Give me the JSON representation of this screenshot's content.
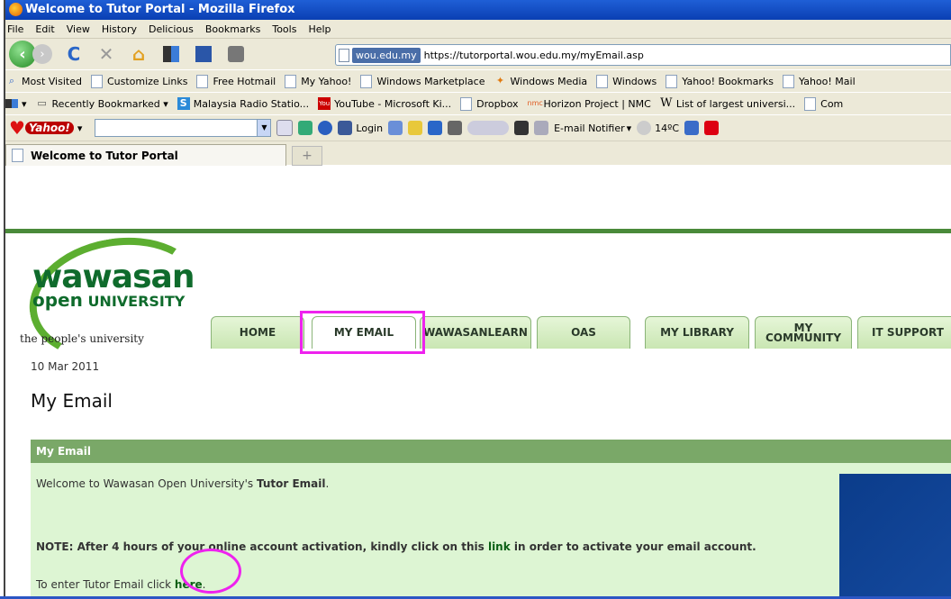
{
  "window": {
    "title": "Welcome to Tutor Portal - Mozilla Firefox"
  },
  "menu": [
    "File",
    "Edit",
    "View",
    "History",
    "Delicious",
    "Bookmarks",
    "Tools",
    "Help"
  ],
  "nav": {
    "site_badge": "wou.edu.my",
    "url": "https://tutorportal.wou.edu.my/myEmail.asp"
  },
  "bookmarks": [
    "Most Visited",
    "Customize Links",
    "Free Hotmail",
    "My Yahoo!",
    "Windows Marketplace",
    "Windows Media",
    "Windows",
    "Yahoo! Bookmarks",
    "Yahoo! Mail"
  ],
  "bookmarks2": [
    "Recently Bookmarked",
    "Malaysia Radio Statio...",
    "YouTube - Microsoft Ki...",
    "Dropbox",
    "Horizon Project | NMC",
    "List of largest universi...",
    "Com"
  ],
  "toolbar3": {
    "brand": "Yahoo!",
    "login": "Login",
    "notifier": "E-mail Notifier",
    "weather": "14ºC"
  },
  "tab": {
    "title": "Welcome to Tutor Portal"
  },
  "site": {
    "logo_word": "wawasan",
    "logo_open": "open",
    "logo_uni": "UNIVERSITY",
    "tagline": "the people's university",
    "tabs": [
      "HOME",
      "MY EMAIL",
      "WAWASANLEARN",
      "OAS",
      "MY LIBRARY",
      "MY COMMUNITY",
      "IT SUPPORT"
    ]
  },
  "page": {
    "date": "10 Mar 2011",
    "heading": "My Email",
    "panel_title": "My Email",
    "welcome_prefix": "Welcome to Wawasan Open University's ",
    "welcome_bold": "Tutor Email",
    "welcome_suffix": ".",
    "note_prefix": "NOTE: After 4 hours of your online account activation, kindly click on this ",
    "note_link": "link",
    "note_suffix": " in order to activate your email account.",
    "enter_prefix": "To enter Tutor Email click ",
    "enter_link": "here",
    "enter_suffix": "."
  },
  "colors": {
    "accent_green": "#4a8a3a",
    "highlight": "#ee22ee",
    "note_red": "#e8001c"
  }
}
